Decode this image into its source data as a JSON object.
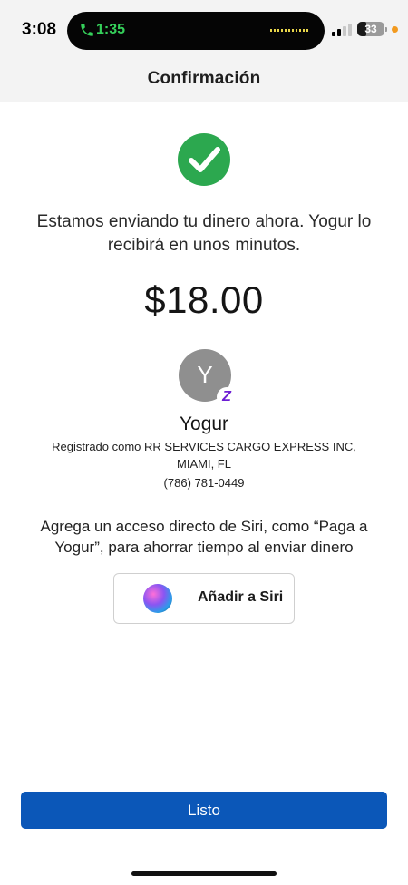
{
  "status_bar": {
    "time": "3:08",
    "call_timer": "1:35",
    "battery": "33",
    "battery_level": 0.33,
    "call_indicator_color": "#35d05a",
    "mic_indicator_color": "#f29a1f"
  },
  "header": {
    "title": "Confirmación"
  },
  "confirmation": {
    "success_icon": "check-circle-icon",
    "success_color": "#2ca84f",
    "message": "Estamos enviando tu dinero ahora. Yogur lo recibirá en unos minutos.",
    "amount": "$18.00"
  },
  "recipient": {
    "initial": "Y",
    "badge_icon": "zelle-icon",
    "badge_text": "Z",
    "name": "Yogur",
    "registered_line1": "Registrado como RR SERVICES CARGO EXPRESS INC,",
    "registered_line2": "MIAMI, FL",
    "phone": "(786) 781-0449"
  },
  "siri": {
    "prompt": "Agrega un acceso directo de Siri, como “Paga a Yogur”, para ahorrar tiempo al enviar dinero",
    "button_label": "Añadir a Siri",
    "icon": "siri-icon"
  },
  "footer": {
    "done_label": "Listo",
    "button_color": "#0b57b8"
  }
}
